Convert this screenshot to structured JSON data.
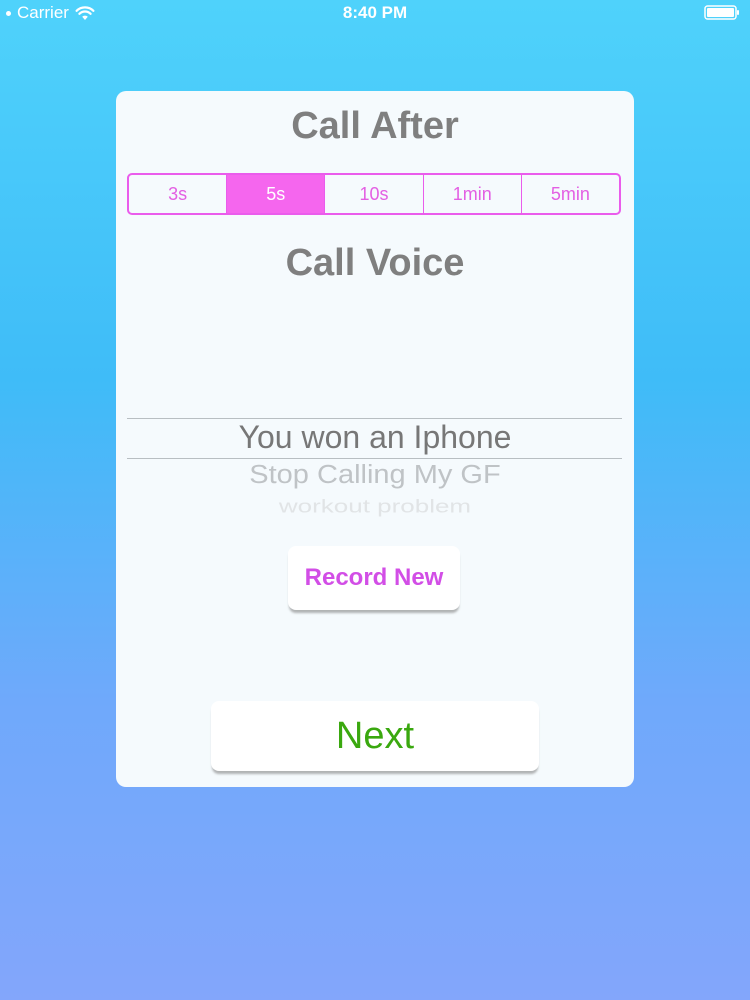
{
  "status_bar": {
    "carrier": "Carrier",
    "time": "8:40 PM"
  },
  "call_after": {
    "title": "Call After",
    "options": [
      "3s",
      "5s",
      "10s",
      "1min",
      "5min"
    ],
    "selected": "5s"
  },
  "call_voice": {
    "title": "Call Voice",
    "picker_items": [
      "You won an Iphone",
      "Stop Calling My GF",
      "workout problem"
    ],
    "selected": "You won an Iphone"
  },
  "buttons": {
    "record_new": "Record New",
    "next": "Next"
  },
  "colors": {
    "accent_magenta": "#ea5cec",
    "segment_selected": "#f566ee",
    "record_text": "#d24ee6",
    "next_text": "#3aa80f",
    "title_gray": "#7f7f7f"
  },
  "icons": {
    "signal": "signal-dots-icon",
    "wifi": "wifi-icon",
    "battery": "battery-icon"
  }
}
